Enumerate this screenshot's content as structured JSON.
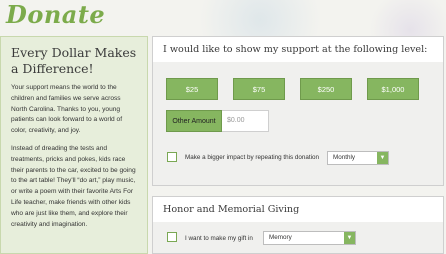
{
  "page_title": "Donate",
  "left": {
    "title": "Every Dollar Makes a Difference!",
    "paragraphs": [
      "Your support means the world to the children and families we serve across North Carolina. Thanks to you, young patients can look forward to a world of color, creativity, and joy.",
      "Instead of dreading the tests and treatments, pricks and pokes, kids race their parents to the car, excited to be going to the art table! They'll “do art,” play music, or write a poem with their favorite Arts For Life teacher, make friends with other kids who are just like them, and explore their creativity and imagination."
    ]
  },
  "support": {
    "heading": "I would like to show my support at the following level:",
    "amounts": [
      "$25",
      "$75",
      "$250",
      "$1,000"
    ],
    "other_label": "Other Amount",
    "other_placeholder": "$0.00",
    "repeat_label": "Make a bigger impact by repeating this donation",
    "frequency_selected": "Monthly"
  },
  "honor": {
    "heading": "Honor and Memorial Giving",
    "gift_label": "I want to make my gift in",
    "gift_selected": "Memory"
  },
  "colors": {
    "brand_green": "#7cab4b",
    "button_green": "#86b660"
  }
}
